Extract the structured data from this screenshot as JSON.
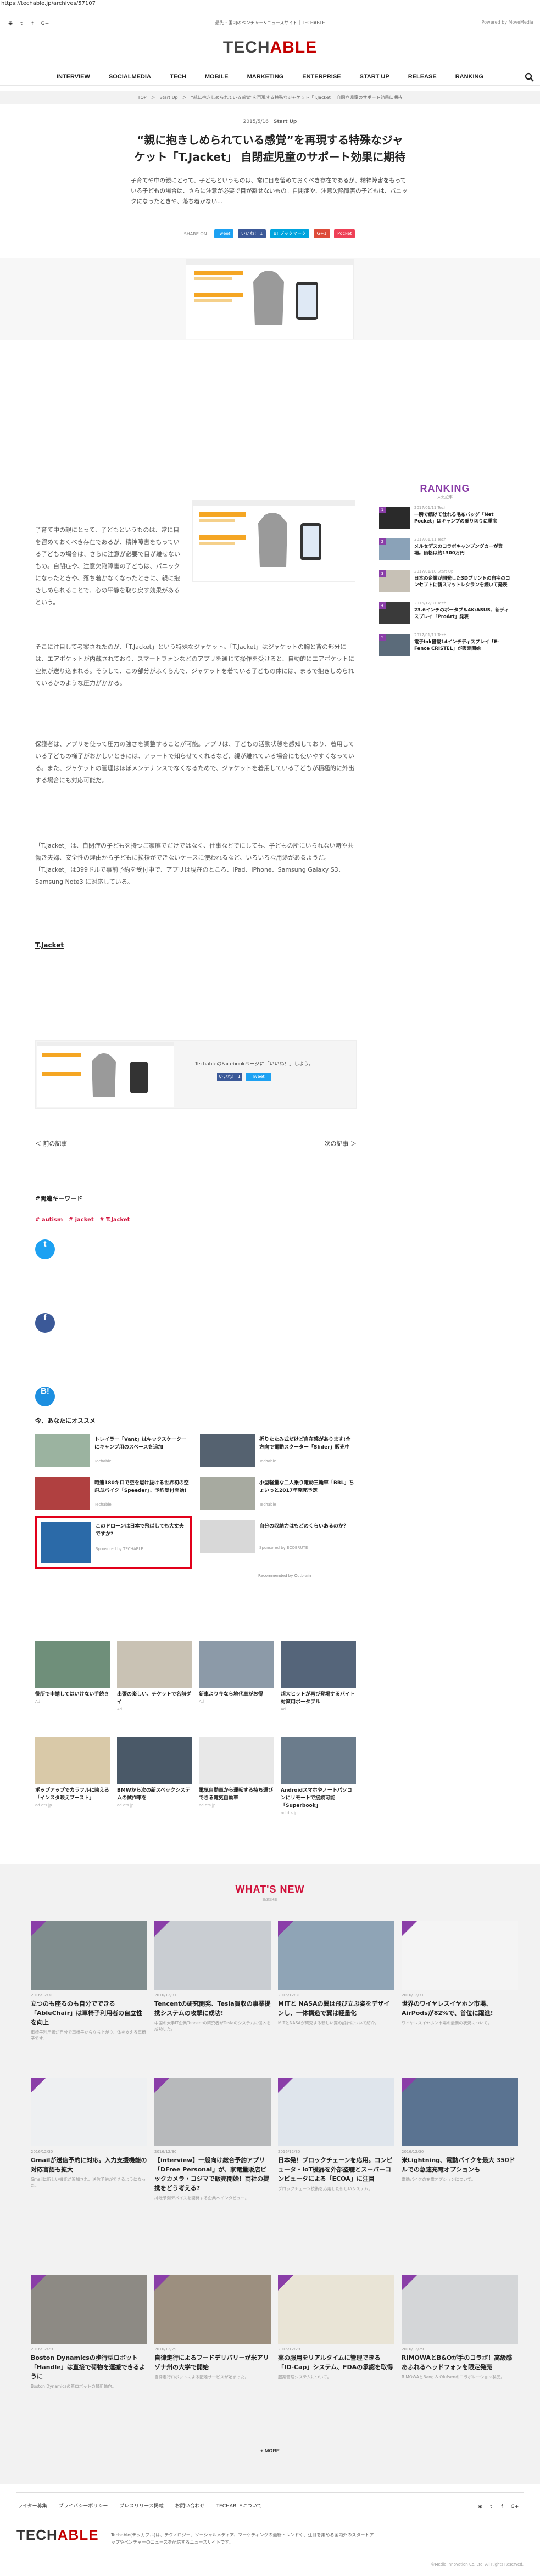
{
  "url": "https://techable.jp/archives/57107",
  "header": {
    "tagline": "最先・国内のベンチャー&ニュースサイト｜TECHABLE",
    "network": "Powered by MoveMedia",
    "logo_a": "TECH",
    "logo_b": "ABLE",
    "social": [
      "rss",
      "twitter",
      "facebook",
      "google-plus"
    ],
    "nav": [
      "INTERVIEW",
      "SOCIALMEDIA",
      "TECH",
      "MOBILE",
      "MARKETING",
      "ENTERPRISE",
      "START UP",
      "RELEASE",
      "RANKING"
    ]
  },
  "breadcrumb": "TOP　＞　Start Up　＞　“親に抱きしめられている感覚”を再現する特殊なジャケット「T.Jacket」 自閉症児童のサポート効果に期待",
  "article": {
    "date": "2015/5/16",
    "category": "Start Up",
    "title": "“親に抱きしめられている感覚”を再現する特殊なジャケット「T.Jacket」 自閉症児童のサポート効果に期待",
    "lead": "子育てや中の親にとって、子どもというものは、常に目を留めておくべき存在であるが、精神障害をもっている子どもの場合は、さらに注意が必要で目が離せないもの。自閉症や、注意欠陥障害の子どもは、パニックになったときや、落ち着かない…",
    "share_label": "SHARE ON",
    "share_buttons": [
      "Tweet",
      "いいね！ 1",
      "B! ブックマーク",
      "G+1",
      "Pocket"
    ],
    "paragraphs": [
      "子育て中の親にとって、子どもというものは、常に目を留めておくべき存在であるが、精神障害をもっている子どもの場合は、さらに注意が必要で目が離せないもの。自閉症や、注意欠陥障害の子どもは、パニックになったときや、落ち着かなくなったときに、親に抱きしめられることで、心の平静を取り戻す効果があるという。",
      "そこに注目して考案されたのが、「T.Jacket」という特殊なジャケット。「T.Jacket」はジャケットの胸と背の部分には、エアポケットが内蔵されており、スマートフォンなどのアプリを通じて操作を受けると、自動的にエアポケットに空気が送り込まれる。そうして、この部分がふくらんで、ジャケットを着ている子どもの体には、まるで抱きしめられているかのような圧力がかかる。",
      "保護者は、アプリを使って圧力の強さを調整することが可能。アプリは、子どもの活動状態を感知しており、着用している子どもの様子がおかしいときには、アラートで知らせてくれるなど、親が離れている場合にも使いやすくなっている。また、ジャケットの管理はほぼメンテナンスでなくなるためで、ジャケットを着用している子どもが積極的に外出する場合にも対応可能だ。",
      "「T.Jacket」は、自閉症の子どもを持つご家庭でだけではなく、仕事などでにしても、子どもの所にいられない時や共働き夫婦、安全性の理由から子どもに挨拶ができないケースに使われるなど、いろいろな用途があるようだ。「T.Jacket」は399ドルで事前予約を受付中で、アプリは現在のところ、iPad、iPhone、Samsung Galaxy S3、Samsung Note3 に対応している。"
    ],
    "source_link": "T.Jacket",
    "prev": "＜ 前の記事",
    "next": "次の記事 ＞",
    "keyword_heading": "#関連キーワード",
    "keywords": [
      "# autism",
      "# jacket",
      "# T.Jacket"
    ],
    "promo_text": "TechableのFacebookページに「いいね！」しよう。"
  },
  "ranking": {
    "heading": "RANKING",
    "sub": "人気記事",
    "items": [
      {
        "n": "1",
        "meta": "2017/01/11 Tech",
        "title": "一瞬で続けて仕れる毛布バッグ「Net Pocket」はキャンプの乗り切りに重宝"
      },
      {
        "n": "2",
        "meta": "2017/01/11 Tech",
        "title": "メルセデスのコラボキャンプングカーが登場。価格は約1300万円"
      },
      {
        "n": "3",
        "meta": "2017/01/10 Start Up",
        "title": "日本の企業が開発した3Dプリントの自宅のコンセプトに新スマットレクランを続いて発表"
      },
      {
        "n": "4",
        "meta": "2016/12/31 Tech",
        "title": "23.6インチのポータブル4K/ASUS、新ディスプレイ「ProArt」発表"
      },
      {
        "n": "5",
        "meta": "2017/01/11 Tech",
        "title": "電子Ink搭載14インチディスプレイ「E-Fence CRISTEL」が販売開始"
      }
    ]
  },
  "recommend": {
    "heading": "今、あなたにオススメ",
    "by": "Recommended by Outbrain",
    "items": [
      {
        "t": "トレイラー「Vant」はキックスケーターにキャンプ用のスペースを追加",
        "s": "Techable"
      },
      {
        "t": "折りたたみ式だけど自在感があります!全方向で電動スクーター「Slider」販売中",
        "s": "Techable"
      },
      {
        "t": "時速180キロで空を駆け抜ける世界初の空飛ぶバイク「Speeder」、予約受付開始!",
        "s": "Techable"
      },
      {
        "t": "小型軽量な二人乗り電動三輪車「BRL」ちょいっと2017年発売予定",
        "s": "Techable"
      },
      {
        "t": "このドローンは日本で飛ばしても大丈夫ですか?",
        "s": "Sponsored by TECHABLE"
      },
      {
        "t": "自分の収納力はもどのくらいあるのか？",
        "s": "Sponsored by ECOBRUTE"
      }
    ]
  },
  "ads": [
    {
      "t": "役所で申請してはいけない手続き",
      "s": "Ad"
    },
    {
      "t": "出張の楽しい、チケットで名前ダイ",
      "s": "Ad"
    },
    {
      "t": "新車より今なら地代車がお得",
      "s": "Ad"
    },
    {
      "t": "超大ヒットが再び登場するバイト対策用ポータブル",
      "s": "Ad"
    },
    {
      "t": "ポップアップでカラフルに映える「インスタ映えブースト」",
      "s": "ad.dts.jp"
    },
    {
      "t": "BMWから次の新スペックシステムの試作車を",
      "s": "ad.dts.jp"
    },
    {
      "t": "電気自動車から運転する持ち運びできる電気自動車",
      "s": "ad.dts.jp"
    },
    {
      "t": "Androidスマホやノートパソコンにリモートで接続可能「Superbook」",
      "s": "ad.dts.jp"
    }
  ],
  "whatsnew": {
    "heading": "WHAT'S NEW",
    "sub": "新着記事",
    "more": "MORE",
    "cards": [
      {
        "d": "2016/12/31",
        "t": "立つのも座るのも自分でできる「AbleChair」は車椅子利用者の自立性を向上",
        "x": "車椅子利用者が自分で車椅子から立ち上がり、体を支える車椅子です。"
      },
      {
        "d": "2016/12/31",
        "t": "Tencentの研究開発、Tesla買収の事業提携システムの攻撃に成功!",
        "x": "中国の大手IT企業Tencentの研究者がTeslaのシステムに侵入を成功した。"
      },
      {
        "d": "2016/12/31",
        "t": "MITと NASAの翼は飛び立ぶ姿をデザインし、一体構造で翼は軽量化",
        "x": "MITとNASAが研究する新しい翼の設計について紹介。"
      },
      {
        "d": "2016/12/31",
        "t": "世界のワイヤレスイヤホン市場、AirPodsが82%で、首位に躍進!",
        "x": "ワイヤレスイヤホン市場の最新の状況について。"
      },
      {
        "d": "2016/12/30",
        "t": "Gmailが送信予約に対応。入力支援機能の対応言語も拡大",
        "x": "Gmailに新しい機能が追加され、送信予約ができるようになった。"
      },
      {
        "d": "2016/12/30",
        "t": "【interview】一般向け総合予約アプリ「DFree Personal」が、家電量販店ビックカメラ・コジマで販売開始！両社の提携をどう考える?",
        "x": "排泄予測デバイスを開発する企業へインタビュー。"
      },
      {
        "d": "2016/12/30",
        "t": "日本発！ブロックチェーンを応用。コンピュータ・IoT機器を外部盗聴とスーパーコンピュータによる「ECOA」に注目",
        "x": "ブロックチェーン技術を応用した新しいシステム。"
      },
      {
        "d": "2016/12/30",
        "t": "米Lightning、電動バイクを最大 350ドルでの急速充電オプションも",
        "x": "電動バイクの充電オプションについて。"
      },
      {
        "d": "2016/12/29",
        "t": "Boston Dynamicsの歩行型ロボット「Handle」は直接で荷物を運搬できるように",
        "x": "Boston Dynamicsの新ロボットの最新動向。"
      },
      {
        "d": "2016/12/29",
        "t": "自律走行によるフードデリバリーが米アリゾナ州の大学で開始",
        "x": "自律走行ロボットによる配達サービスが始まった。"
      },
      {
        "d": "2016/12/29",
        "t": "薬の服用をリアルタイムに管理できる「ID-Cap」システム、FDAの承認を取得",
        "x": "服薬管理システムについて。"
      },
      {
        "d": "2016/12/29",
        "t": "RIMOWAとB&Oが手のコラボ！高級感あふれるヘッドフォンを限定発売",
        "x": "RIMOWAとBang & Olufsenのコラボレーション製品。"
      }
    ]
  },
  "footer": {
    "links": [
      "ライター募集",
      "プライバシーポリシー",
      "プレスリリース掲載",
      "お問い合わせ",
      "TECHABLEについて"
    ],
    "logo_a": "TECH",
    "logo_b": "ABLE",
    "desc": "Techable(テッカブル)は、テクノロジー、ソーシャルメディア、マーケティングの最新トレンドや、注目を集める国内外のスタートアップやベンチャーのニュースを配信するニュースサイトです。",
    "copy": "©Media Innovation Co.,Ltd. All Rights Reserved."
  },
  "colors": {
    "purple": "#8a3ea8",
    "red": "#d0103a",
    "twitter": "#1da1f2",
    "facebook": "#3b5998"
  }
}
